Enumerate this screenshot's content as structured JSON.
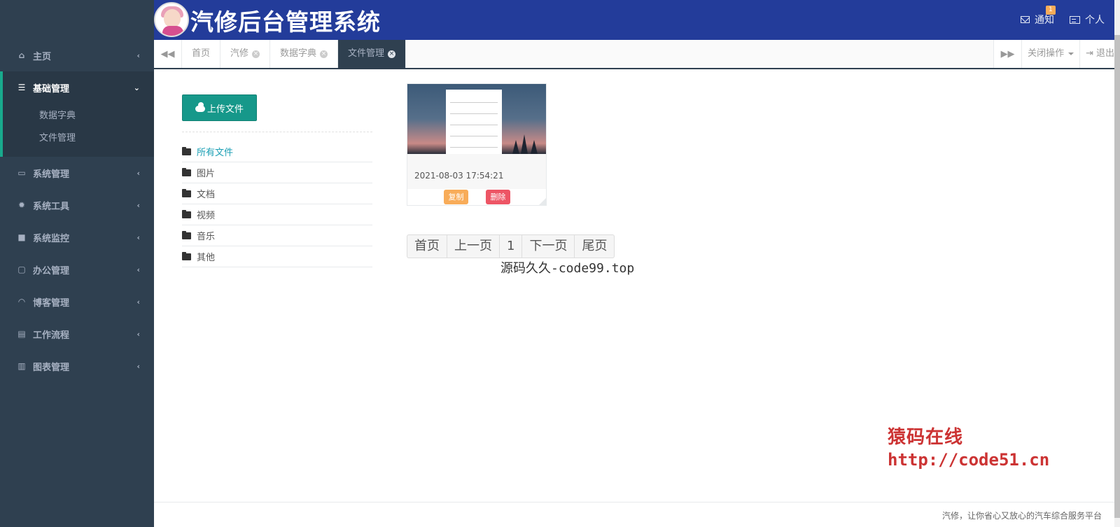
{
  "app": {
    "title": "汽修后台管理系统"
  },
  "colors": {
    "sidebar": "#2f4050",
    "header": "#233c9a",
    "accent": "#16988a",
    "active_border": "#19aa8d",
    "warning": "#f8ac59",
    "danger": "#ed5565"
  },
  "header": {
    "notify_label": "通知",
    "notify_badge": "1",
    "profile_label": "个人"
  },
  "sidebar": {
    "items": [
      {
        "label": "主页",
        "icon": "home-icon"
      },
      {
        "label": "基础管理",
        "icon": "list-icon",
        "expanded": true,
        "children": [
          {
            "label": "数据字典"
          },
          {
            "label": "文件管理"
          }
        ]
      },
      {
        "label": "系统管理",
        "icon": "desktop-icon"
      },
      {
        "label": "系统工具",
        "icon": "gear-icon"
      },
      {
        "label": "系统监控",
        "icon": "video-camera-icon"
      },
      {
        "label": "办公管理",
        "icon": "laptop-icon"
      },
      {
        "label": "博客管理",
        "icon": "rss-icon"
      },
      {
        "label": "工作流程",
        "icon": "print-icon"
      },
      {
        "label": "图表管理",
        "icon": "bar-chart-icon"
      }
    ]
  },
  "tabs": {
    "items": [
      {
        "label": "首页"
      },
      {
        "label": "汽修"
      },
      {
        "label": "数据字典"
      },
      {
        "label": "文件管理",
        "active": true
      }
    ],
    "close_ops_label": "关闭操作",
    "logout_label": "退出"
  },
  "content": {
    "upload_label": "上传文件",
    "folders": [
      {
        "label": "所有文件",
        "active": true
      },
      {
        "label": "图片"
      },
      {
        "label": "文档"
      },
      {
        "label": "视频"
      },
      {
        "label": "音乐"
      },
      {
        "label": "其他"
      }
    ],
    "file": {
      "date": "2021-08-03 17:54:21",
      "copy_label": "复制",
      "delete_label": "删除"
    },
    "pager": {
      "first": "首页",
      "prev": "上一页",
      "current": "1",
      "next": "下一页",
      "last": "尾页"
    },
    "source_note": "源码久久-code99.top",
    "watermark": {
      "line1": "猿码在线",
      "line2": "http://code51.cn"
    }
  },
  "footer": {
    "text": "汽修，让你省心又放心的汽车综合服务平台"
  }
}
